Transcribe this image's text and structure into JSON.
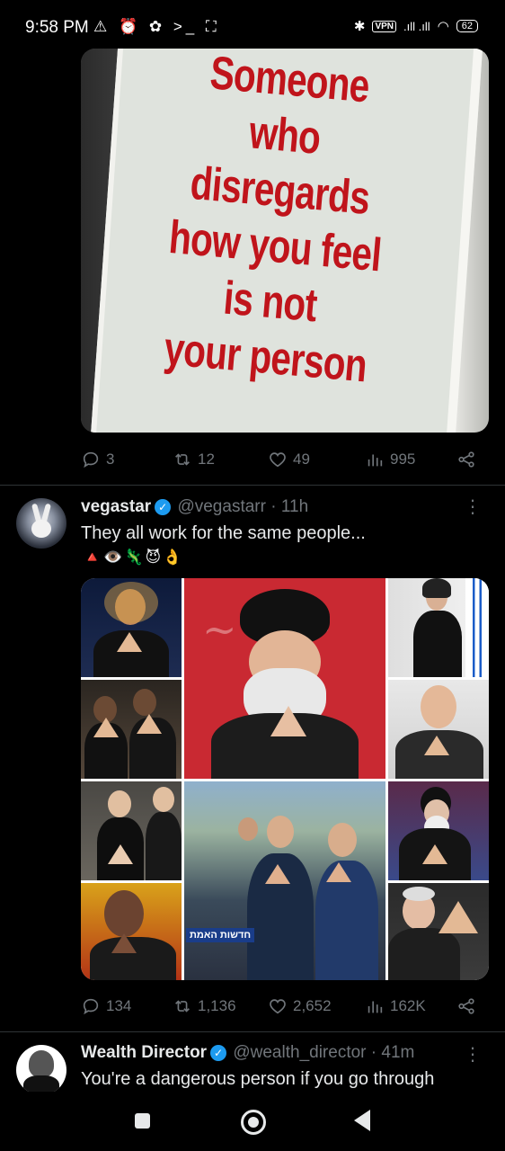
{
  "status_bar": {
    "time": "9:58 PM",
    "left_icons": "⚠ ⏰ ✿ >_ ⛶",
    "vpn": "VPN",
    "signal": ".ıll .ıll",
    "battery": "62"
  },
  "tweet1": {
    "image_text": "Someone who disregards how you feel is not your person",
    "sign_lines": [
      "Someone who",
      "disregards",
      "how you feel",
      "is not",
      "your person"
    ],
    "replies": "3",
    "reposts": "12",
    "likes": "49",
    "views": "995"
  },
  "tweet2": {
    "name": "vegastar",
    "handle": "@vegastarr",
    "time": "11h",
    "text": "They all work for the same people...",
    "emojis": "🔺👁️🦎😈👌",
    "news_caption": "חדשות האמת",
    "replies": "134",
    "reposts": "1,136",
    "likes": "2,652",
    "views": "162K"
  },
  "tweet3": {
    "name": "Wealth Director",
    "handle": "@wealth_director",
    "time": "41m",
    "text": "You're a dangerous person if you go through"
  },
  "colors": {
    "background": "#000000",
    "text": "#e7e9ea",
    "muted": "#71767b",
    "verified": "#1d9bf0",
    "sign_red": "#c0141b"
  }
}
